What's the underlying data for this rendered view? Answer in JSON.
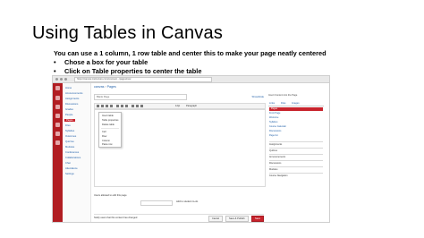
{
  "slide": {
    "title": "Using Tables in Canvas",
    "intro": "You can use a 1 column, 1 row table and center this to make your page neatly centered",
    "bullets": [
      "Chose a box for your table",
      "Click on Table properties to center the table"
    ]
  },
  "screenshot": {
    "url": "https://canvas.instructure.com/courses/.../pages/new",
    "breadcrumb": [
      "canvas",
      "Pages"
    ],
    "course_nav": [
      "Home",
      "Announcements",
      "Assignments",
      "Discussions",
      "Grades",
      "People",
      "Pages",
      "Files",
      "Syllabus",
      "Outcomes",
      "Quizzes",
      "Modules",
      "Conferences",
      "Collaborations",
      "Chat",
      "Attendance",
      "Settings"
    ],
    "active_course_nav": "Pages",
    "title_field": "Blank Page",
    "right_link": "Show/Hide",
    "toolbar_font": "Paragraph",
    "toolbar_size": "12pt",
    "context_menu": [
      "Insert table",
      "Table properties",
      "Delete table",
      "Cell",
      "Row",
      "Column",
      "Paste row"
    ],
    "right_panel_heading": "Insert Content into the Page",
    "right_panel_tabs": [
      "Links",
      "Files",
      "Images"
    ],
    "right_panel_items": [
      "Pages",
      "Front Page",
      "Welcome",
      "Syllabus",
      "Course Calendar",
      "Discussions",
      "Page list"
    ],
    "right_panel_groups": [
      "Assignments",
      "Quizzes",
      "Announcements",
      "Discussions",
      "Modules",
      "Course Navigation"
    ],
    "bottom_labels": [
      "Users allowed to edit this page",
      "Add to student to-do"
    ],
    "notify_label": "Notify users that this content has changed",
    "cancel_label": "Cancel",
    "save_publish_label": "Save & Publish",
    "save_label": "Save"
  }
}
